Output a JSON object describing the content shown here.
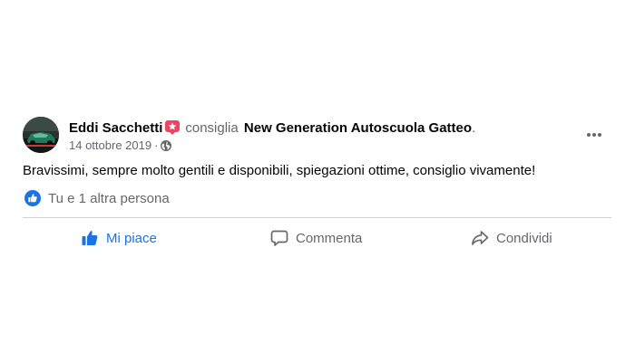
{
  "post": {
    "author": "Eddi Sacchetti",
    "verb": "consiglia",
    "page_name": "New Generation Autoscuola Gatteo",
    "period": ".",
    "date": "14 ottobre 2019",
    "separator": "·",
    "privacy_icon": "globe-icon",
    "badge_icon": "recommend-star-badge-icon",
    "body": "Bravissimi, sempre molto gentili e disponibili, spiegazioni ottime, consiglio vivamente!"
  },
  "reactions": {
    "icon": "like-reaction-icon",
    "summary": "Tu e 1 altra persona"
  },
  "actions": {
    "like_label": "Mi piace",
    "comment_label": "Commenta",
    "share_label": "Condividi"
  },
  "colors": {
    "accent": "#1b74e4",
    "secondary_text": "#65676b",
    "badge": "#f3425f",
    "divider": "#ced0d4"
  }
}
